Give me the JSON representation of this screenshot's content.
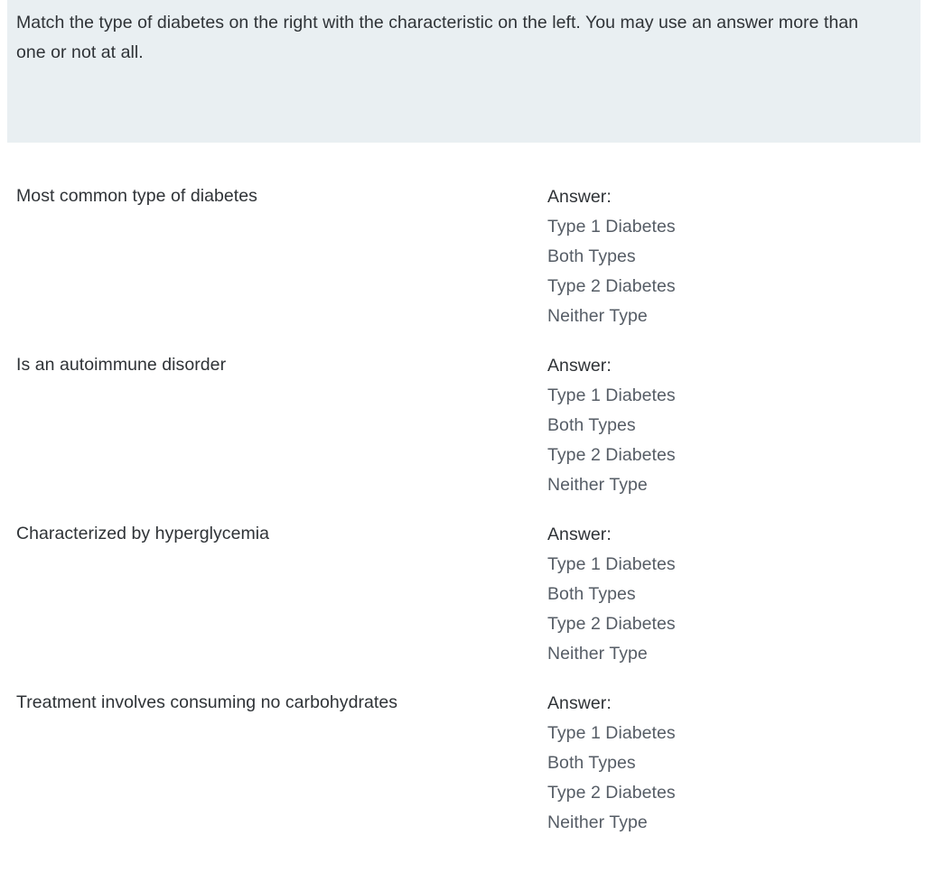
{
  "prompt": {
    "text": "Match the type of diabetes on the right with the characteristic on the left. You may use an answer more than one or not at all."
  },
  "colors": {
    "banner_background": "#e9eff2",
    "page_background": "#ffffff",
    "primary_text": "#2f3337",
    "option_text": "#565d66"
  },
  "questions": [
    {
      "stem": "Most common type of diabetes",
      "answer_label": "Answer:",
      "options": [
        "Type 1 Diabetes",
        "Both Types",
        "Type 2 Diabetes",
        "Neither Type"
      ]
    },
    {
      "stem": "Is an autoimmune disorder",
      "answer_label": "Answer:",
      "options": [
        "Type 1 Diabetes",
        "Both Types",
        "Type 2 Diabetes",
        "Neither Type"
      ]
    },
    {
      "stem": "Characterized by hyperglycemia",
      "answer_label": "Answer:",
      "options": [
        "Type 1 Diabetes",
        "Both Types",
        "Type 2 Diabetes",
        "Neither Type"
      ]
    },
    {
      "stem": "Treatment involves consuming no carbohydrates",
      "answer_label": "Answer:",
      "options": [
        "Type 1 Diabetes",
        "Both Types",
        "Type 2 Diabetes",
        "Neither Type"
      ]
    }
  ]
}
